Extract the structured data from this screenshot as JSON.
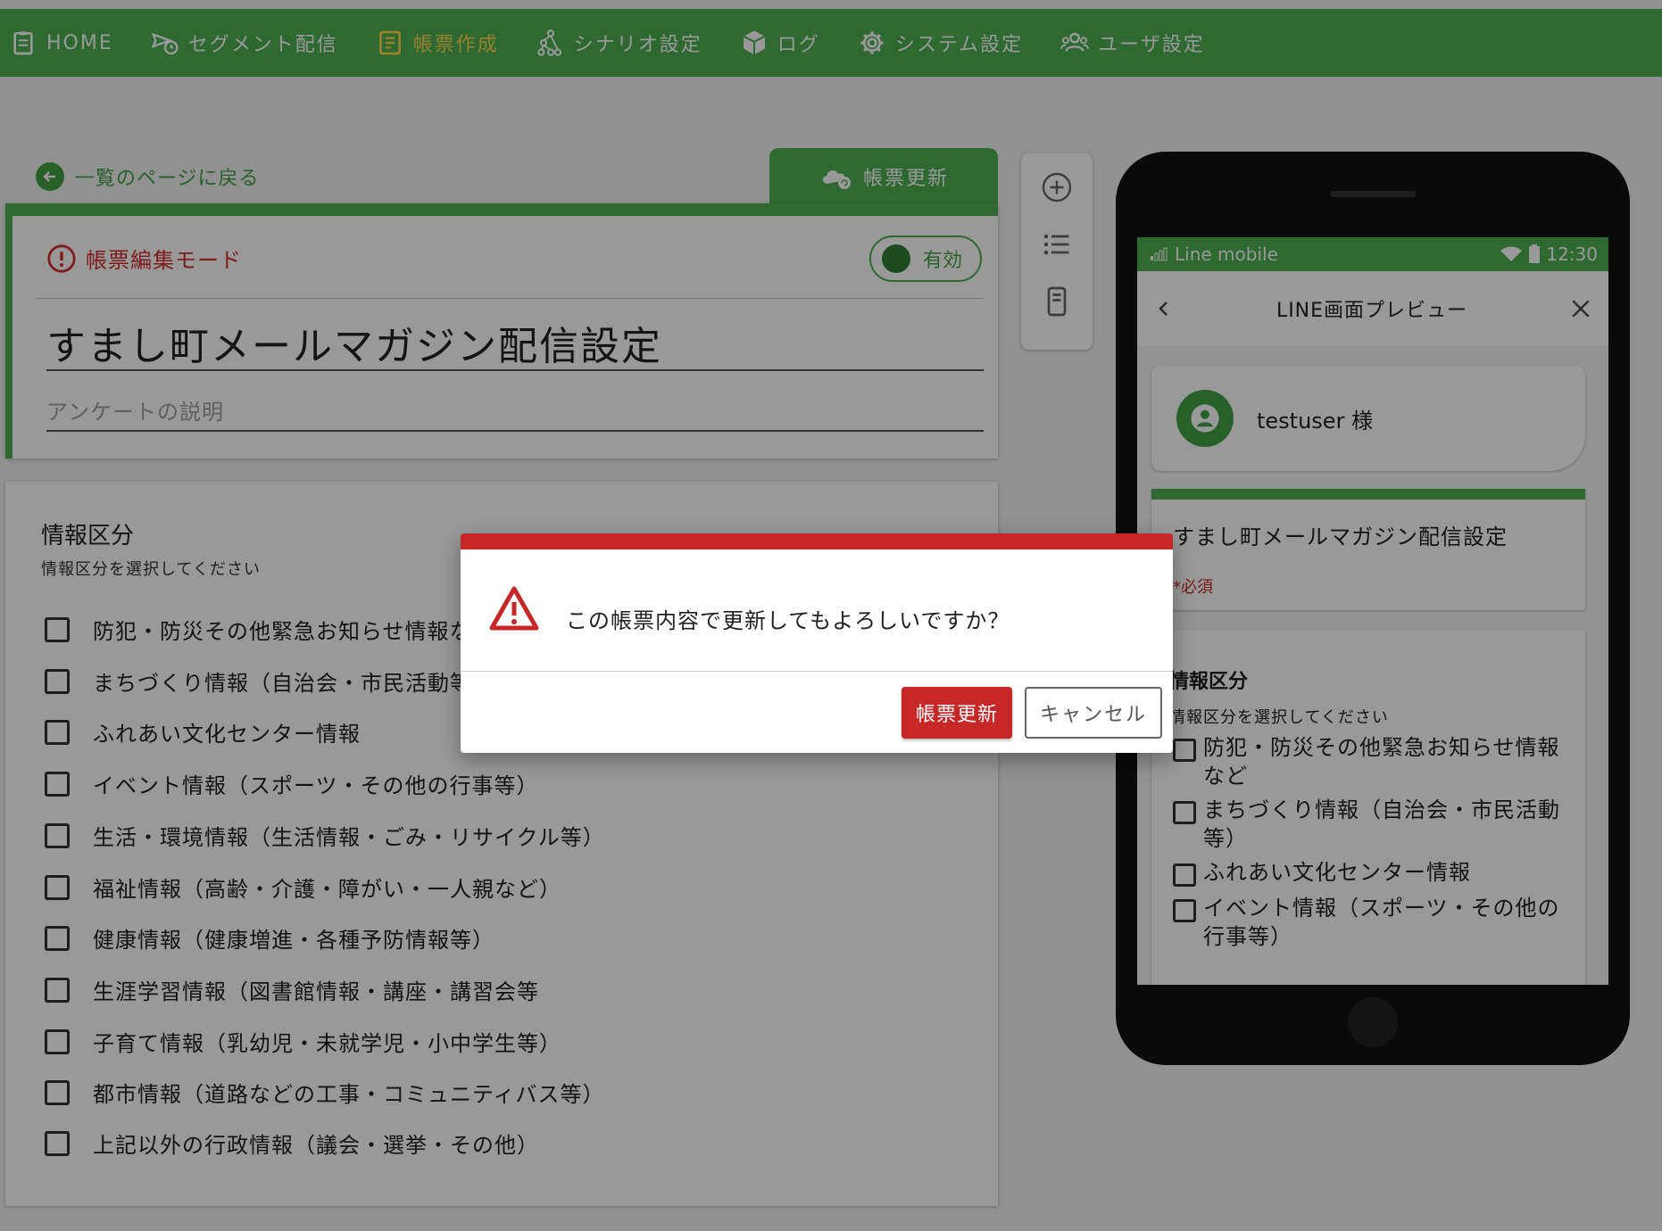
{
  "nav": {
    "home": "HOME",
    "segment": "セグメント配信",
    "forms": "帳票作成",
    "scenario": "シナリオ設定",
    "log": "ログ",
    "system": "システム設定",
    "users": "ユーザ設定"
  },
  "editor": {
    "back_label": "一覧のページに戻る",
    "update_tab_label": "帳票更新",
    "edit_mode_label": "帳票編集モード",
    "toggle_label": "有効",
    "title_value": "すまし町メールマガジン配信設定",
    "description_placeholder": "アンケートの説明",
    "question_title": "情報区分",
    "question_subtitle": "情報区分を選択してください",
    "options": [
      "防犯・防災その他緊急お知らせ情報など",
      "まちづくり情報（自治会・市民活動等）",
      "ふれあい文化センター情報",
      "イベント情報（スポーツ・その他の行事等）",
      "生活・環境情報（生活情報・ごみ・リサイクル等）",
      "福祉情報（高齢・介護・障がい・一人親など）",
      "健康情報（健康増進・各種予防情報等）",
      "生涯学習情報（図書館情報・講座・講習会等",
      "子育て情報（乳幼児・未就学児・小中学生等）",
      "都市情報（道路などの工事・コミュニティバス等）",
      "上記以外の行政情報（議会・選挙・その他）"
    ]
  },
  "preview": {
    "carrier": "Line mobile",
    "time": "12:30",
    "header_title": "LINE画面プレビュー",
    "user_name": "testuser 様",
    "form_title": "すまし町メールマガジン配信設定",
    "required_label": "*必須",
    "question_title": "情報区分",
    "question_subtitle": "情報区分を選択してください",
    "options": [
      "防犯・防災その他緊急お知らせ情報など",
      "まちづくり情報（自治会・市民活動等）",
      "ふれあい文化センター情報",
      "イベント情報（スポーツ・その他の行事等）"
    ]
  },
  "dialog": {
    "message": "この帳票内容で更新してもよろしいですか？",
    "confirm_label": "帳票更新",
    "cancel_label": "キャンセル"
  },
  "colors": {
    "brand_green": "#4caf50",
    "active_nav": "#ffd54f",
    "danger_red": "#c62828"
  }
}
